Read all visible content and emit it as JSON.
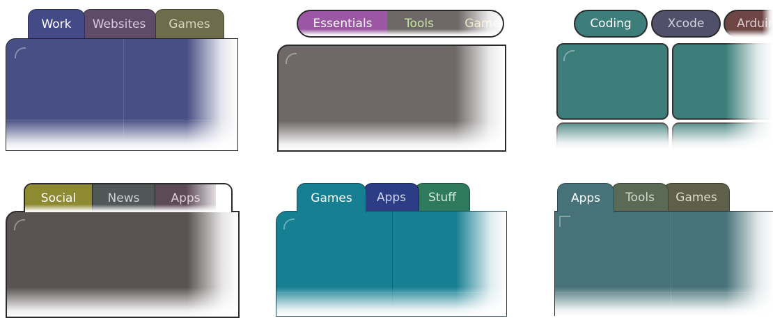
{
  "widget1": {
    "tabs": [
      {
        "label": "Work"
      },
      {
        "label": "Websites"
      },
      {
        "label": "Games"
      }
    ]
  },
  "widget2": {
    "tabs": [
      {
        "label": "Essentials"
      },
      {
        "label": "Tools"
      },
      {
        "label": "Games"
      }
    ]
  },
  "widget3": {
    "tabs": [
      {
        "label": "Coding"
      },
      {
        "label": "Xcode"
      },
      {
        "label": "Arduino"
      }
    ]
  },
  "widget4": {
    "tabs": [
      {
        "label": "Social"
      },
      {
        "label": "News"
      },
      {
        "label": "Apps"
      }
    ]
  },
  "widget5": {
    "tabs": [
      {
        "label": "Games"
      },
      {
        "label": "Apps"
      },
      {
        "label": "Stuff"
      }
    ]
  },
  "widget6": {
    "tabs": [
      {
        "label": "Apps"
      },
      {
        "label": "Tools"
      },
      {
        "label": "Games"
      }
    ]
  },
  "colors": {
    "navy": "#474f84",
    "gray": "#6e6968",
    "teal": "#3d7e7b",
    "olive": "#8e8a32",
    "cyan": "#167f92",
    "slate_teal": "#477279"
  }
}
